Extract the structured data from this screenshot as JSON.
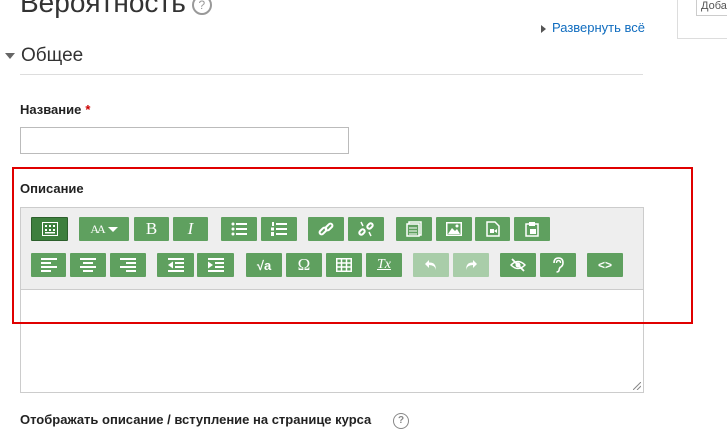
{
  "page": {
    "title": "Вероятность"
  },
  "right_panel": {
    "input_value": "Добавить"
  },
  "header": {
    "expand_all": "Развернуть всё"
  },
  "section": {
    "title": "Общее"
  },
  "name_field": {
    "label": "Название",
    "required_mark": "*",
    "value": ""
  },
  "description": {
    "label": "Описание",
    "toolbar_row1": [
      "toggle-toolbar",
      "font-size",
      "bold",
      "italic",
      "bullet-list",
      "numbered-list",
      "link",
      "unlink",
      "manage-files",
      "image",
      "media",
      "paste-text"
    ],
    "toolbar_row2": [
      "align-left",
      "align-center",
      "align-right",
      "outdent",
      "indent",
      "equation",
      "special-char",
      "table",
      "clear-formatting",
      "undo",
      "redo",
      "accessibility-checker",
      "screenreader-helper",
      "html-source"
    ],
    "bold_glyph": "B",
    "italic_glyph": "I",
    "omega_glyph": "Ω",
    "clear_glyph": "Tx",
    "html_glyph": "<>",
    "equation_glyph": "√a",
    "font_glyph": "AA"
  },
  "show_description": {
    "label": "Отображать описание / вступление на странице курса",
    "help": "?"
  },
  "colors": {
    "button_green": "#5fa05f",
    "highlight_red": "#e00000",
    "link_blue": "#0f6cbf"
  }
}
